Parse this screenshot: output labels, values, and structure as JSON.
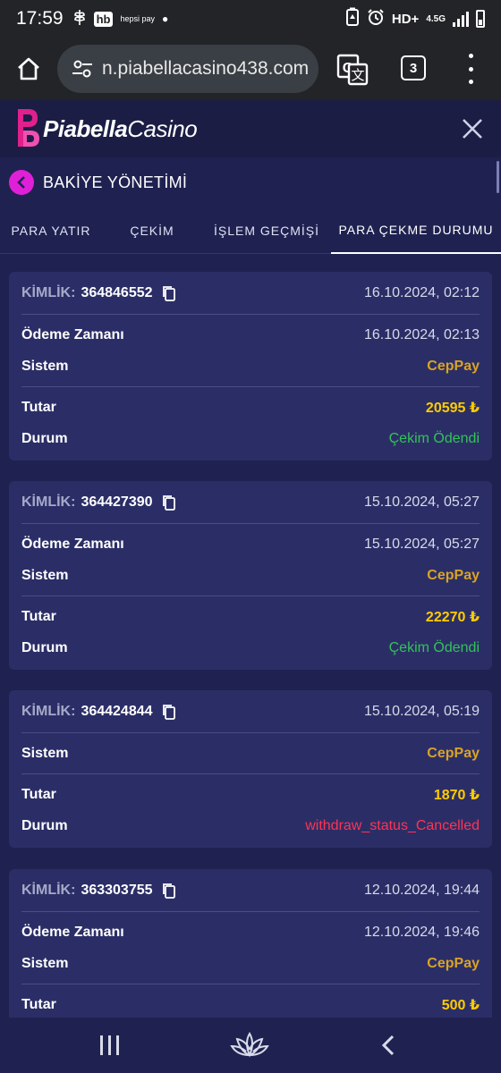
{
  "status_bar": {
    "time": "17:59",
    "hb_label": "hb",
    "hepsipay_label": "hepsi pay",
    "network_label": "4.5G",
    "hd_label": "HD+"
  },
  "browser": {
    "url": "n.piabellacasino438.com",
    "tab_count": "3"
  },
  "header": {
    "logo_piabella": "Piabella",
    "logo_casino": "Casino"
  },
  "section": {
    "title": "BAKİYE YÖNETİMİ"
  },
  "tabs": [
    {
      "label": "PARA YATIR"
    },
    {
      "label": "ÇEKİM"
    },
    {
      "label": "İŞLEM GEÇMİŞİ"
    },
    {
      "label": "PARA ÇEKME DURUMU"
    }
  ],
  "labels": {
    "id_label": "KİMLİK:",
    "payment_time": "Ödeme Zamanı",
    "system": "Sistem",
    "amount": "Tutar",
    "status": "Durum"
  },
  "transactions": [
    {
      "id": "364846552",
      "created": "16.10.2024, 02:12",
      "payment_time": "16.10.2024, 02:13",
      "system": "CepPay",
      "amount": "20595 ₺",
      "status": "Çekim Ödendi"
    },
    {
      "id": "364427390",
      "created": "15.10.2024, 05:27",
      "payment_time": "15.10.2024, 05:27",
      "system": "CepPay",
      "amount": "22270 ₺",
      "status": "Çekim Ödendi"
    },
    {
      "id": "364424844",
      "created": "15.10.2024, 05:19",
      "system": "CepPay",
      "amount": "1870 ₺",
      "status": "withdraw_status_Cancelled"
    },
    {
      "id": "363303755",
      "created": "12.10.2024, 19:44",
      "payment_time": "12.10.2024, 19:46",
      "system": "CepPay",
      "amount": "500 ₺"
    }
  ],
  "colors": {
    "background": "#1f2250",
    "card": "#2b2e66",
    "accent_pink": "#e020d8",
    "system_gold": "#d9a326",
    "amount_yellow": "#ffcc00",
    "status_paid_green": "#33c25a",
    "status_cancelled_red": "#ff3355"
  }
}
